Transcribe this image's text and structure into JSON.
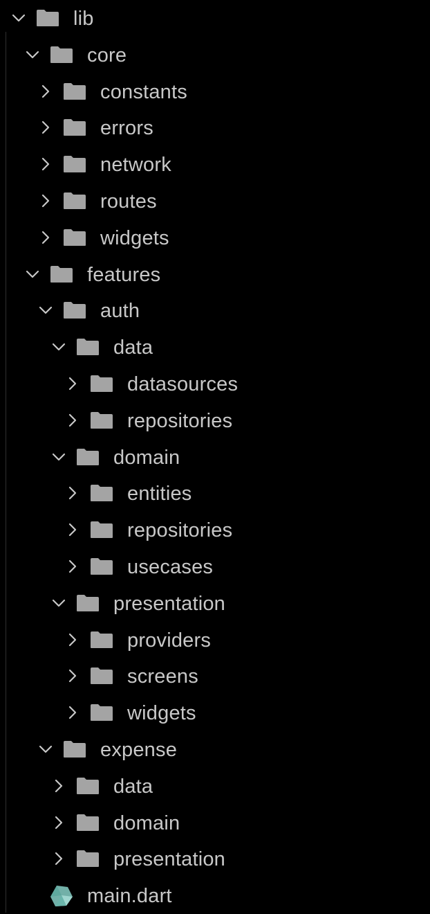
{
  "colors": {
    "background": "#000000",
    "text": "#c8c8c8",
    "folder_icon": "#a4a4a4",
    "chevron": "#c8c8c8",
    "indent_guide": "#2f2f2f",
    "dart_file_icon": "#7ec3ba"
  },
  "tree": [
    {
      "label": "lib",
      "kind": "folder",
      "expanded": true,
      "depth": 0,
      "icon": "folder-icon"
    },
    {
      "label": "core",
      "kind": "folder",
      "expanded": true,
      "depth": 1,
      "icon": "folder-icon"
    },
    {
      "label": "constants",
      "kind": "folder",
      "expanded": false,
      "depth": 2,
      "icon": "folder-icon"
    },
    {
      "label": "errors",
      "kind": "folder",
      "expanded": false,
      "depth": 2,
      "icon": "folder-icon"
    },
    {
      "label": "network",
      "kind": "folder",
      "expanded": false,
      "depth": 2,
      "icon": "folder-icon"
    },
    {
      "label": "routes",
      "kind": "folder",
      "expanded": false,
      "depth": 2,
      "icon": "folder-icon"
    },
    {
      "label": "widgets",
      "kind": "folder",
      "expanded": false,
      "depth": 2,
      "icon": "folder-icon"
    },
    {
      "label": "features",
      "kind": "folder",
      "expanded": true,
      "depth": 1,
      "icon": "folder-icon"
    },
    {
      "label": "auth",
      "kind": "folder",
      "expanded": true,
      "depth": 2,
      "icon": "folder-icon"
    },
    {
      "label": "data",
      "kind": "folder",
      "expanded": true,
      "depth": 3,
      "icon": "folder-icon"
    },
    {
      "label": "datasources",
      "kind": "folder",
      "expanded": false,
      "depth": 4,
      "icon": "folder-icon"
    },
    {
      "label": "repositories",
      "kind": "folder",
      "expanded": false,
      "depth": 4,
      "icon": "folder-icon"
    },
    {
      "label": "domain",
      "kind": "folder",
      "expanded": true,
      "depth": 3,
      "icon": "folder-icon"
    },
    {
      "label": "entities",
      "kind": "folder",
      "expanded": false,
      "depth": 4,
      "icon": "folder-icon"
    },
    {
      "label": "repositories",
      "kind": "folder",
      "expanded": false,
      "depth": 4,
      "icon": "folder-icon"
    },
    {
      "label": "usecases",
      "kind": "folder",
      "expanded": false,
      "depth": 4,
      "icon": "folder-icon"
    },
    {
      "label": "presentation",
      "kind": "folder",
      "expanded": true,
      "depth": 3,
      "icon": "folder-icon"
    },
    {
      "label": "providers",
      "kind": "folder",
      "expanded": false,
      "depth": 4,
      "icon": "folder-icon"
    },
    {
      "label": "screens",
      "kind": "folder",
      "expanded": false,
      "depth": 4,
      "icon": "folder-icon"
    },
    {
      "label": "widgets",
      "kind": "folder",
      "expanded": false,
      "depth": 4,
      "icon": "folder-icon"
    },
    {
      "label": "expense",
      "kind": "folder",
      "expanded": true,
      "depth": 2,
      "icon": "folder-icon"
    },
    {
      "label": "data",
      "kind": "folder",
      "expanded": false,
      "depth": 3,
      "icon": "folder-icon"
    },
    {
      "label": "domain",
      "kind": "folder",
      "expanded": false,
      "depth": 3,
      "icon": "folder-icon"
    },
    {
      "label": "presentation",
      "kind": "folder",
      "expanded": false,
      "depth": 3,
      "icon": "folder-icon"
    },
    {
      "label": "main.dart",
      "kind": "file",
      "expanded": null,
      "depth": 1,
      "icon": "dart-file-icon"
    }
  ]
}
